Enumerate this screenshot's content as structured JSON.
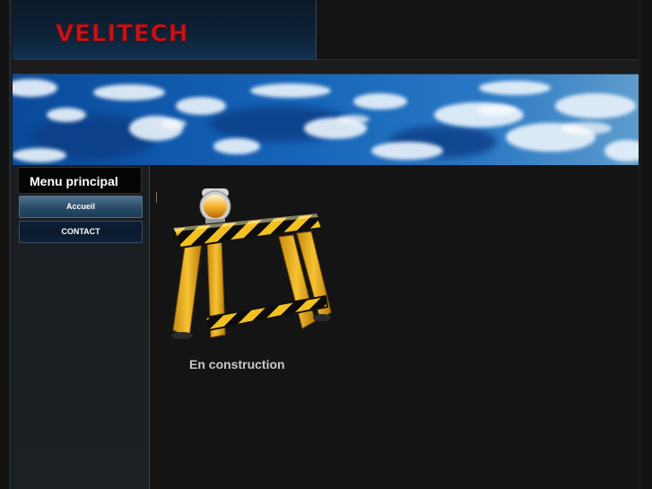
{
  "header": {
    "logo_text": "VELITECH"
  },
  "sidebar": {
    "menu_title": "Menu principal",
    "items": [
      {
        "label": "Accueil",
        "active": true
      },
      {
        "label": "CONTACT",
        "active": false
      }
    ]
  },
  "main": {
    "status_text": "En construction"
  },
  "colors": {
    "logo_red": "#c0161e",
    "header_blue": "#0d2338",
    "background": "#141414",
    "barrier_yellow": "#f2b01e",
    "barrier_black": "#111111"
  }
}
